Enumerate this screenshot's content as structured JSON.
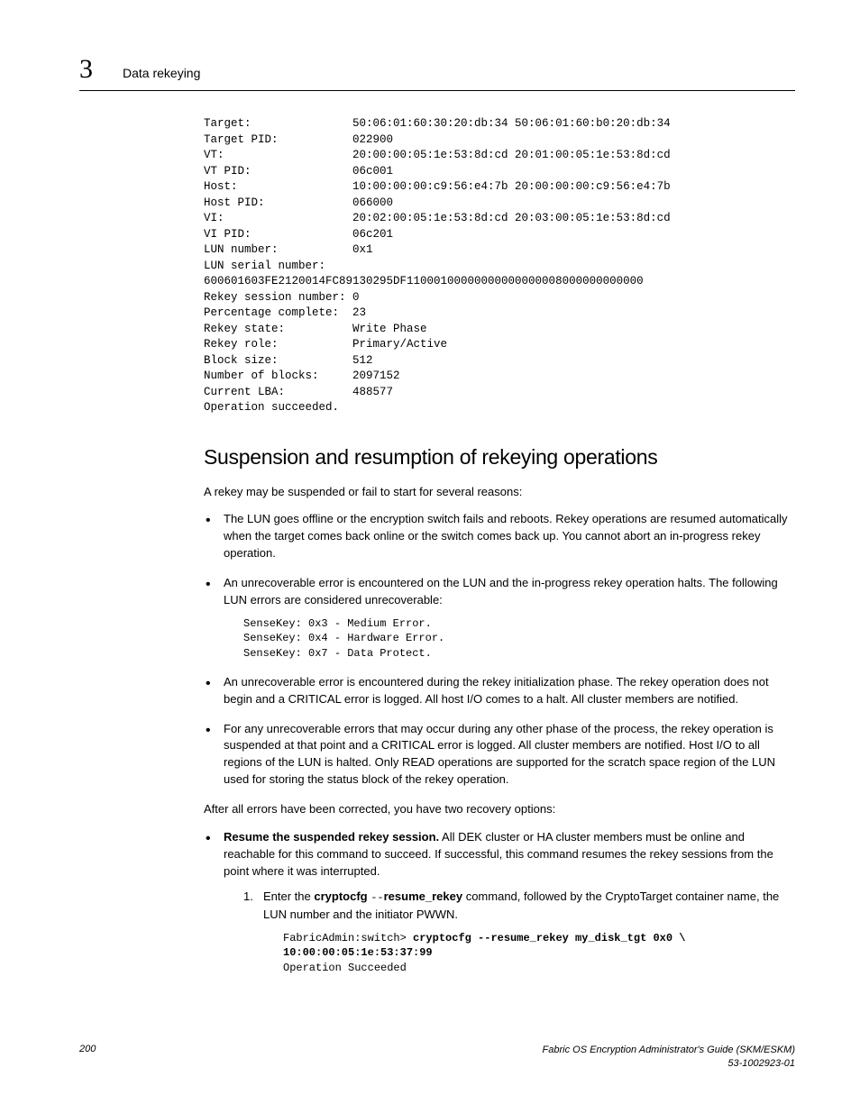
{
  "header": {
    "chapter": "3",
    "title": "Data rekeying"
  },
  "terminal_output": "Target:               50:06:01:60:30:20:db:34 50:06:01:60:b0:20:db:34\nTarget PID:           022900\nVT:                   20:00:00:05:1e:53:8d:cd 20:01:00:05:1e:53:8d:cd\nVT PID:               06c001\nHost:                 10:00:00:00:c9:56:e4:7b 20:00:00:00:c9:56:e4:7b\nHost PID:             066000\nVI:                   20:02:00:05:1e:53:8d:cd 20:03:00:05:1e:53:8d:cd\nVI PID:               06c201\nLUN number:           0x1\nLUN serial number:\n600601603FE2120014FC89130295DF11000100000000000000008000000000000\nRekey session number: 0\nPercentage complete:  23\nRekey state:          Write Phase\nRekey role:           Primary/Active\nBlock size:           512\nNumber of blocks:     2097152\nCurrent LBA:          488577\nOperation succeeded.",
  "section": {
    "heading": "Suspension and resumption of rekeying operations",
    "intro": "A rekey may be suspended or fail to start for several reasons:",
    "bullets": [
      "The LUN goes offline or the encryption switch fails and reboots. Rekey operations are resumed automatically when the target comes back online or the switch comes back up. You cannot abort an in-progress rekey operation.",
      "An unrecoverable error is encountered on the LUN and the in-progress rekey operation halts. The following LUN errors are considered unrecoverable:",
      "An unrecoverable error is encountered during the rekey initialization phase. The rekey operation does not begin and a CRITICAL error is logged. All host I/O comes to a halt. All cluster members are notified.",
      "For any unrecoverable errors that may occur during any other phase of the process, the rekey operation is suspended at that point and a CRITICAL error is logged. All cluster members are notified. Host I/O to all regions of the LUN is halted. Only READ operations are supported for the scratch space region of the LUN used for storing the status block of the rekey operation."
    ],
    "sensekey_block": "SenseKey: 0x3 - Medium Error.\nSenseKey: 0x4 - Hardware Error.\nSenseKey: 0x7 - Data Protect.",
    "after_errors": "After all errors have been corrected, you have two recovery options:",
    "resume_bold": "Resume the suspended rekey session.",
    "resume_rest": " All DEK cluster or HA cluster members must be online and reachable for this command to succeed. If successful, this command resumes the rekey sessions from the point where it was interrupted.",
    "step1_pre": "Enter the ",
    "step1_cmd1": "cryptocfg ",
    "step1_dashes": "--",
    "step1_cmd2": "resume_rekey",
    "step1_post": " command, followed by the CryptoTarget container name, the LUN number and the initiator PWWN.",
    "command_prompt": "FabricAdmin:switch> ",
    "command_bold": "cryptocfg --resume_rekey my_disk_tgt 0x0 \\\n10:00:00:05:1e:53:37:99",
    "command_result": "Operation Succeeded"
  },
  "footer": {
    "page": "200",
    "doc_title": "Fabric OS Encryption Administrator's Guide (SKM/ESKM)",
    "doc_id": "53-1002923-01"
  }
}
